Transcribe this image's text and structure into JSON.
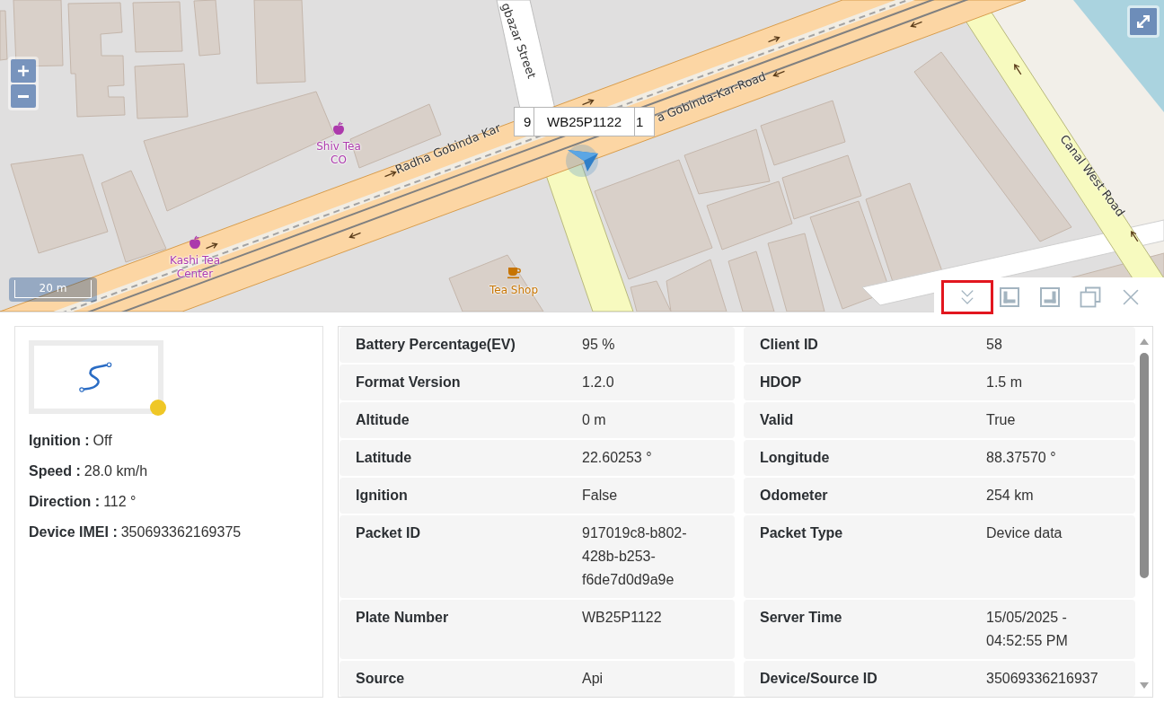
{
  "map": {
    "streets": [
      {
        "name": "gbazar Street"
      },
      {
        "name": "Radha Gobinda Kar"
      },
      {
        "name": "a Gobinda-Kar-Road"
      },
      {
        "name": "Canal West Road"
      }
    ],
    "places": [
      {
        "name": "Shiv Tea CO",
        "kind": "apple"
      },
      {
        "name": "Kashi Tea Center",
        "kind": "apple"
      },
      {
        "name": "Tea Shop",
        "kind": "cup"
      }
    ],
    "vehicle_labels": [
      "9",
      "WB25P1122",
      "1"
    ],
    "scale": "20 m"
  },
  "toolbar": [
    {
      "kind": "collapse",
      "highlighted": true
    },
    {
      "kind": "dock-left",
      "highlighted": false
    },
    {
      "kind": "dock-right",
      "highlighted": false
    },
    {
      "kind": "popout",
      "highlighted": false
    },
    {
      "kind": "close",
      "highlighted": false
    }
  ],
  "vehicle_card": {
    "status_dot": {
      "color": "#efc726"
    },
    "info": [
      {
        "label": "Ignition :",
        "value": "Off"
      },
      {
        "label": "Speed :",
        "value": "28.0 km/h"
      },
      {
        "label": "Direction :",
        "value": "112 °"
      },
      {
        "label": "Device IMEI :",
        "value": "350693362169375"
      }
    ]
  },
  "details": {
    "fields": [
      {
        "label": "Battery Percentage(EV)",
        "value": "95 %"
      },
      {
        "label": "Client ID",
        "value": "58"
      },
      {
        "label": "Format Version",
        "value": "1.2.0"
      },
      {
        "label": "HDOP",
        "value": "1.5 m"
      },
      {
        "label": "Altitude",
        "value": "0 m"
      },
      {
        "label": "Valid",
        "value": "True"
      },
      {
        "label": "Latitude",
        "value": "22.60253 °"
      },
      {
        "label": "Longitude",
        "value": "88.37570 °"
      },
      {
        "label": "Ignition",
        "value": "False"
      },
      {
        "label": "Odometer",
        "value": "254 km"
      },
      {
        "label": "Packet ID",
        "value": "917019c8-b802-428b-b253-f6de7d0d9a9e"
      },
      {
        "label": "Packet Type",
        "value": "Device data"
      },
      {
        "label": "Plate Number",
        "value": "WB25P1122"
      },
      {
        "label": "Server Time",
        "value": "15/05/2025 - 04:52:55 PM"
      },
      {
        "label": "Source",
        "value": "Api"
      },
      {
        "label": "Device/Source ID",
        "value": "35069336216937"
      }
    ]
  }
}
